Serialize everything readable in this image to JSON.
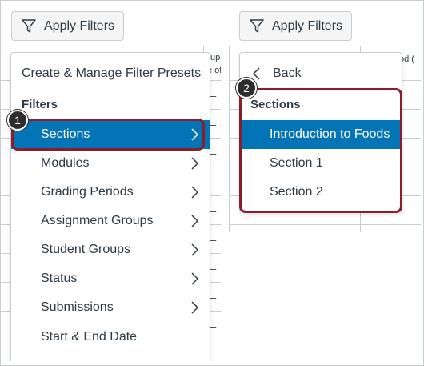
{
  "left": {
    "apply_filters": "Apply Filters",
    "header_fragment_1": "up",
    "header_fragment_2": "e of",
    "row_dash": "–",
    "menu": {
      "preset_link": "Create & Manage Filter Presets",
      "heading": "Filters",
      "items": [
        {
          "label": "Sections",
          "selected": true
        },
        {
          "label": "Modules"
        },
        {
          "label": "Grading Periods"
        },
        {
          "label": "Assignment Groups"
        },
        {
          "label": "Student Groups"
        },
        {
          "label": "Status"
        },
        {
          "label": "Submissions"
        },
        {
          "label": "Start & End Date"
        }
      ]
    },
    "callout": "1"
  },
  "right": {
    "apply_filters": "Apply Filters",
    "header_fragment": "od (",
    "menu": {
      "back": "Back",
      "heading": "Sections",
      "items": [
        {
          "label": "Introduction to Foods",
          "selected": true
        },
        {
          "label": "Section 1"
        },
        {
          "label": "Section 2"
        }
      ]
    },
    "callout": "2"
  },
  "colors": {
    "accent": "#0374b5",
    "callout_border": "#8b1d2c",
    "badge": "#2d2d2d",
    "text": "#2d3b45",
    "border": "#c7cdd1"
  },
  "icons": {
    "filter": "filter-funnel-icon",
    "chevron": "chevron-right-icon",
    "back": "chevron-left-icon"
  }
}
